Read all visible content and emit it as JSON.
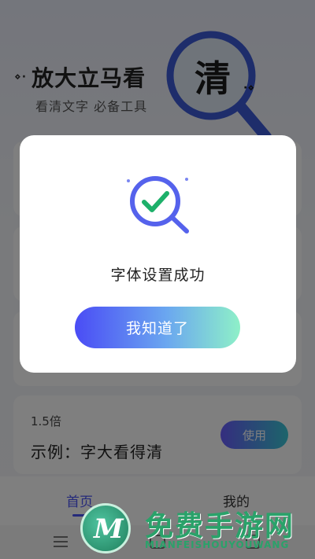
{
  "hero": {
    "title": "放大立马看",
    "title_big": "清",
    "subtitle": "看清文字  必备工具",
    "dots_left": "⋄·",
    "dots_right": "·⋄"
  },
  "cards": {
    "example_ratio": "1.5倍",
    "example_text": "示例：字大看得清",
    "use_label": "使用"
  },
  "tabbar": {
    "home_label": "首页",
    "mine_label": "我的"
  },
  "dialog": {
    "message": "字体设置成功",
    "confirm_label": "我知道了",
    "icon": "magnifier-check-icon"
  },
  "watermark": {
    "cn": "免费手游网",
    "en": "MIANFEISHOUYOUWANG"
  },
  "colors": {
    "accent": "#4a55f5",
    "check": "#1db06a",
    "overlay": "rgba(0,0,0,0.5)"
  }
}
